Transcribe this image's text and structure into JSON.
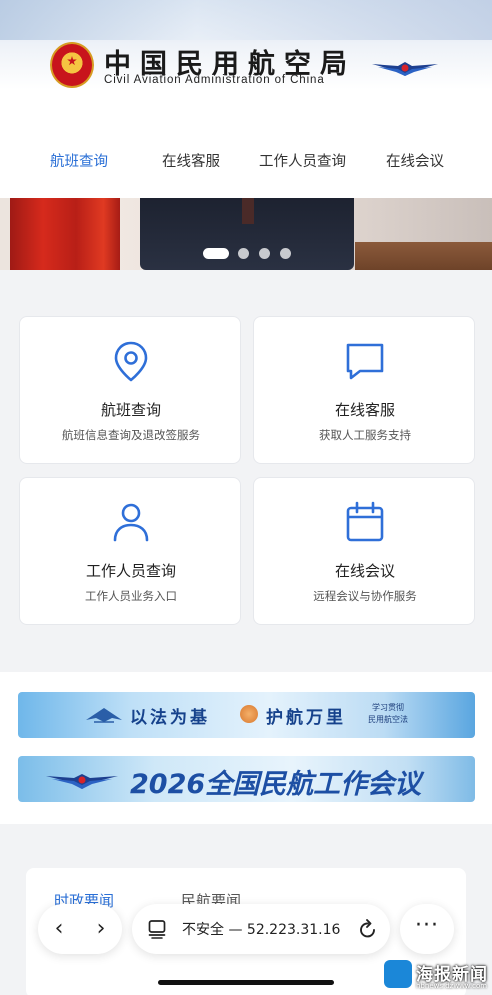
{
  "header": {
    "title_cn": "中国民用航空局",
    "title_en": "Civil Aviation Administration of China"
  },
  "tabs": [
    {
      "label": "航班查询",
      "active": true
    },
    {
      "label": "在线客服",
      "active": false
    },
    {
      "label": "工作人员查询",
      "active": false
    },
    {
      "label": "在线会议",
      "active": false
    }
  ],
  "carousel": {
    "slide_count": 4,
    "active_index": 0
  },
  "services": [
    {
      "title": "航班查询",
      "subtitle": "航班信息查询及退改签服务",
      "icon": "location-pin-icon"
    },
    {
      "title": "在线客服",
      "subtitle": "获取人工服务支持",
      "icon": "chat-bubble-icon"
    },
    {
      "title": "工作人员查询",
      "subtitle": "工作人员业务入口",
      "icon": "user-icon"
    },
    {
      "title": "在线会议",
      "subtitle": "远程会议与协作服务",
      "icon": "calendar-icon"
    }
  ],
  "promos": {
    "promo1_left": "以法为基",
    "promo1_right": "护航万里",
    "promo1_side_line1": "学习贯彻",
    "promo1_side_line2": "民用航空法",
    "promo2_title": "2026全国民航工作会议"
  },
  "news": {
    "tabs": [
      "时政要闻",
      "民航要闻"
    ],
    "active_tab": 0
  },
  "browser": {
    "back": "‹",
    "forward": "›",
    "security": "不安全",
    "separator": "—",
    "address": "52.223.31.16",
    "more": "···"
  },
  "watermark": {
    "name": "海报新闻",
    "sub": "hbnews.dzwww.com"
  },
  "colors": {
    "accent": "#2a6fd6",
    "icon_blue": "#2f6fd8",
    "text_dark": "#222222"
  }
}
